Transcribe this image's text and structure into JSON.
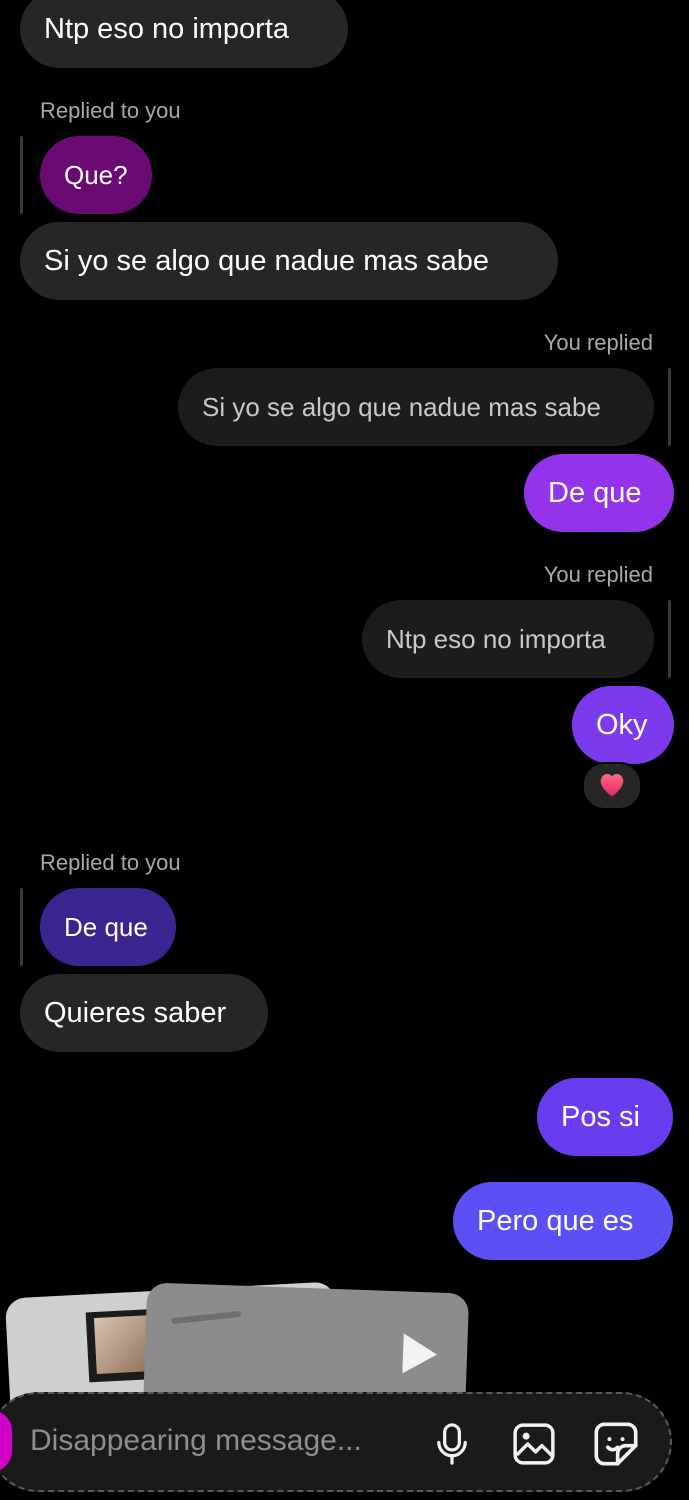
{
  "messages": {
    "m1": "Ntp eso no importa",
    "m2_label": "Replied to you",
    "m2_quote": "Que?",
    "m3": "Si yo se algo que nadue mas sabe",
    "m4_label": "You replied",
    "m4_quote": "Si yo se algo que nadue mas sabe",
    "m5": "De que",
    "m6_label": "You replied",
    "m6_quote": "Ntp eso no importa",
    "m7": "Oky",
    "m8_label": "Replied to you",
    "m8_quote": "De que",
    "m9": "Quieres saber",
    "m10": "Pos si",
    "m11": "Pero que es"
  },
  "composer": {
    "placeholder": "Disappearing message..."
  },
  "icons": {
    "reaction": "heart-icon",
    "mic": "mic-icon",
    "gallery": "gallery-icon",
    "sticker": "sticker-icon",
    "play": "play-icon"
  },
  "colors": {
    "received_bubble": "#262626",
    "sent_purple": "#9333ea",
    "sent_violet": "#6a3cf0",
    "sent_blue": "#5b4ff5",
    "quote_purple": "#6b0a73",
    "quote_indigo": "#3b2590",
    "composer_accent": "#d300c5"
  }
}
